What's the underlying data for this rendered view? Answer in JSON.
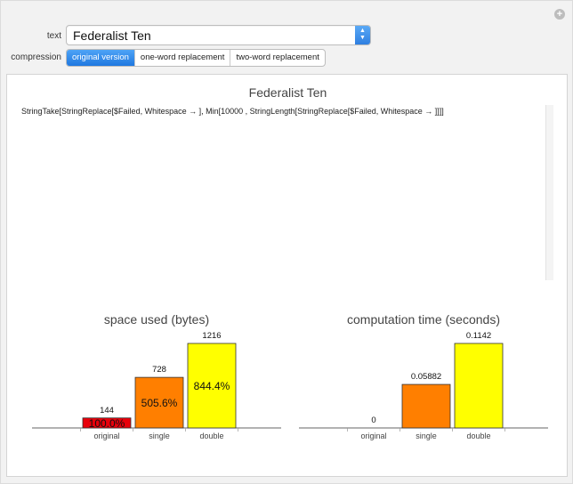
{
  "controls": {
    "text_label": "text",
    "text_value": "Federalist Ten",
    "compression_label": "compression",
    "compression_options": [
      "original version",
      "one-word replacement",
      "two-word replacement"
    ],
    "compression_selected": 0
  },
  "output": {
    "title": "Federalist Ten",
    "expression": "StringTake[StringReplace[$Failed, Whitespace → ], Min[10000 , StringLength[StringReplace[$Failed, Whitespace → ]]]]"
  },
  "chart_data": [
    {
      "type": "bar",
      "title": "space used (bytes)",
      "categories": [
        "original",
        "single",
        "double"
      ],
      "values": [
        144,
        728,
        1216
      ],
      "value_labels": [
        "144",
        "728",
        "1216"
      ],
      "inner_labels": [
        "100.0%",
        "505.6%",
        "844.4%"
      ],
      "colors": [
        "#e8000b",
        "#ff7f00",
        "#ffff00"
      ],
      "ylim": [
        0,
        1216
      ],
      "grid": false
    },
    {
      "type": "bar",
      "title": "computation time (seconds)",
      "categories": [
        "original",
        "single",
        "double"
      ],
      "values": [
        0,
        0.05882,
        0.1142
      ],
      "value_labels": [
        "0",
        "0.05882",
        "0.1142"
      ],
      "colors": [
        "#e8000b",
        "#ff7f00",
        "#ffff00"
      ],
      "ylim": [
        0,
        0.1142
      ],
      "grid": false
    }
  ]
}
